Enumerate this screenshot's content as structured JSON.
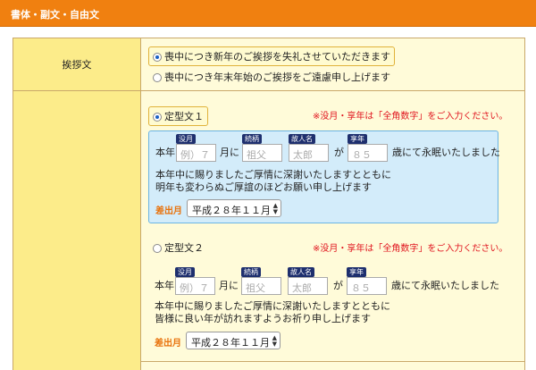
{
  "header": {
    "title": "書体・副文・自由文"
  },
  "rows": {
    "greeting": {
      "label": "挨拶文",
      "options": [
        {
          "text": "喪中につき新年のご挨拶を失礼させていただきます",
          "selected": true
        },
        {
          "text": "喪中につき年末年始のご挨拶をご遠慮申し上げます",
          "selected": false
        }
      ]
    },
    "templates": {
      "label": "",
      "items": [
        {
          "name": "定型文１",
          "selected": true,
          "notice": "※没月・享年は「全角数字」をご入力ください。",
          "prefix": "本年",
          "month_tag": "没月",
          "month_placeholder": "例）７",
          "month_suffix": "月に",
          "relation_tag": "続柄",
          "relation_placeholder": "祖父",
          "name_tag": "故人名",
          "name_placeholder": "太郎",
          "particle": "が",
          "age_tag": "享年",
          "age_placeholder": "８５",
          "age_suffix": "歳にて永眠いたしました",
          "body_line1": "本年中に賜りましたご厚情に深謝いたしますとともに",
          "body_line2": "明年も変わらぬご厚誼のほどお願い申し上げます",
          "date_label": "差出月",
          "date_value": "平成２８年１１月"
        },
        {
          "name": "定型文２",
          "selected": false,
          "notice": "※没月・享年は「全角数字」をご入力ください。",
          "prefix": "本年",
          "month_tag": "没月",
          "month_placeholder": "例）７",
          "month_suffix": "月に",
          "relation_tag": "続柄",
          "relation_placeholder": "祖父",
          "name_tag": "故人名",
          "name_placeholder": "太郎",
          "particle": "が",
          "age_tag": "享年",
          "age_placeholder": "８５",
          "age_suffix": "歳にて永眠いたしました",
          "body_line1": "本年中に賜りましたご厚情に深謝いたしますとともに",
          "body_line2": "皆様に良い年が訪れますようお祈り申し上げます",
          "date_label": "差出月",
          "date_value": "平成２８年１１月"
        }
      ]
    }
  }
}
